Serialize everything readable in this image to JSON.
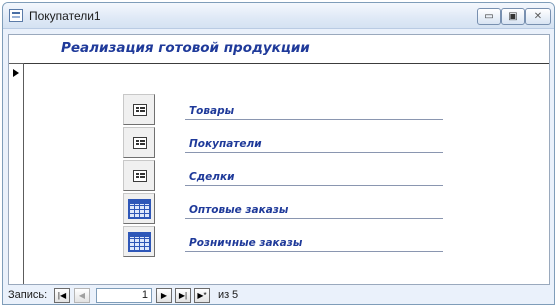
{
  "window": {
    "title": "Покупатели1",
    "controls": {
      "minimize": "▭",
      "maximize": "▣",
      "close": "✕"
    }
  },
  "form": {
    "header_title": "Реализация готовой продукции",
    "menu_items": [
      {
        "label": "Товары",
        "icon": "form-icon"
      },
      {
        "label": "Покупатели",
        "icon": "form-icon"
      },
      {
        "label": "Сделки",
        "icon": "form-icon"
      },
      {
        "label": "Оптовые заказы",
        "icon": "table-icon"
      },
      {
        "label": "Розничные заказы",
        "icon": "table-icon"
      }
    ]
  },
  "navigation": {
    "caption": "Запись:",
    "first": "|◀",
    "prev": "◀",
    "current": "1",
    "next": "▶",
    "last": "▶|",
    "new": "▶*",
    "of_label": "из",
    "total": "5"
  }
}
